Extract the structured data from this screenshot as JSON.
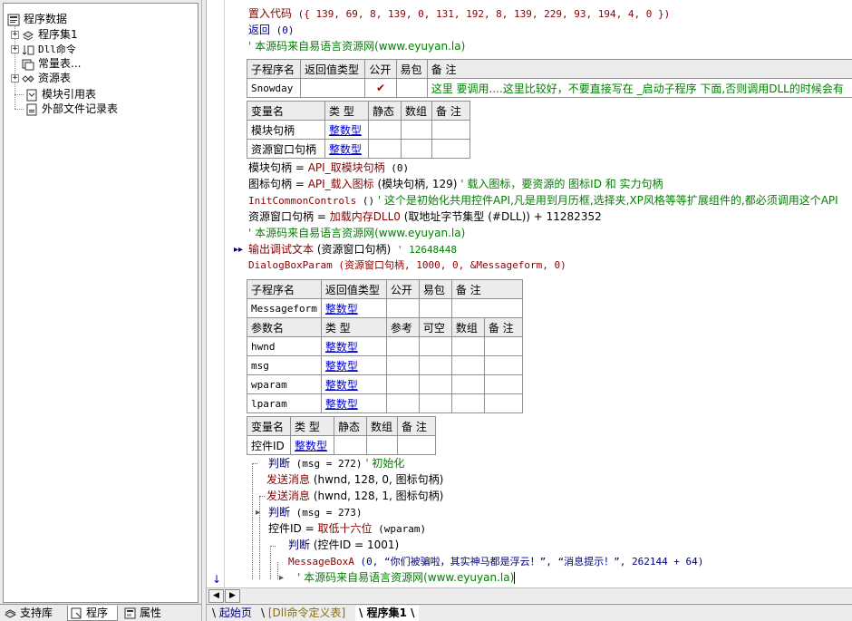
{
  "tree": {
    "root": "程序数据",
    "items": [
      {
        "label": "程序集1",
        "icon": "assembly-icon"
      },
      {
        "label": "Dll命令",
        "icon": "dll-icon"
      },
      {
        "label": "常量表...",
        "icon": "constant-icon"
      },
      {
        "label": "资源表",
        "icon": "resource-icon"
      },
      {
        "label": "模块引用表",
        "icon": "module-icon"
      },
      {
        "label": "外部文件记录表",
        "icon": "file-icon"
      }
    ]
  },
  "left_tabs": [
    "支持库",
    "程序",
    "属性"
  ],
  "code": {
    "l1_kw": "置入代码",
    "l1_args": " ({ 139, 69, 8, 139, 0, 131, 192, 8, 139, 229, 93, 194, 4, 0 })",
    "l2_kw": "返回",
    "l2_args": " (0)",
    "l3": "' 本源码来自易语言资源网(www.eyuyan.la)",
    "sub1": {
      "headers": [
        "子程序名",
        "返回值类型",
        "公开",
        "易包",
        "备 注"
      ],
      "name": "Snowday",
      "note": "这里 要调用....这里比较好，不要直接写在 _启动子程序 下面,否则调用DLL的时候会有"
    },
    "vars1": {
      "headers": [
        "变量名",
        "类 型",
        "静态",
        "数组",
        "备 注"
      ],
      "rows": [
        [
          "模块句柄",
          "整数型"
        ],
        [
          "资源窗口句柄",
          "整数型"
        ]
      ]
    },
    "l4_a": "模块句柄 = ",
    "l4_b": "API_取模块句柄",
    "l4_c": " (0)",
    "l5_a": "图标句柄 = ",
    "l5_b": "API_载入图标",
    "l5_c": " (模块句柄, 129)",
    "l5_d": " ' 载入图标，要资源的 图标ID 和 实力句柄",
    "l6_a": "InitCommonControls",
    "l6_b": " ()",
    "l6_c": " ' 这个是初始化共用控件API,凡是用到月历框,选择夹,XP风格等等扩展组件的,都必须调用这个API",
    "l7_a": "资源窗口句柄 = ",
    "l7_b": "加载内存DLL0",
    "l7_c": " (取地址字节集型 (#DLL)) + 11282352",
    "l8": "' 本源码来自易语言资源网(www.eyuyan.la)",
    "l9_a": "输出调试文本",
    "l9_b": " (资源窗口句柄)",
    "l9_c": " ' 12648448",
    "l10": "DialogBoxParam (资源窗口句柄, 1000, 0, &Messageform, 0)",
    "sub2": {
      "headers": [
        "子程序名",
        "返回值类型",
        "公开",
        "易包",
        "备 注"
      ],
      "name": "Messageform",
      "ret": "整数型",
      "param_headers": [
        "参数名",
        "类 型",
        "参考",
        "可空",
        "数组",
        "备 注"
      ],
      "params": [
        [
          "hwnd",
          "整数型"
        ],
        [
          "msg",
          "整数型"
        ],
        [
          "wparam",
          "整数型"
        ],
        [
          "lparam",
          "整数型"
        ]
      ]
    },
    "vars2": {
      "headers": [
        "变量名",
        "类 型",
        "静态",
        "数组",
        "备 注"
      ],
      "rows": [
        [
          "控件ID",
          "整数型"
        ]
      ]
    },
    "l11_a": "判断",
    "l11_b": " (msg = 272)",
    "l11_c": " ' 初始化",
    "l12_a": "发送消息",
    "l12_b": " (hwnd, 128, 0, 图标句柄)",
    "l13_a": "发送消息",
    "l13_b": " (hwnd, 128, 1, 图标句柄)",
    "l14_a": "判断",
    "l14_b": " (msg = 273)",
    "l15_a": "控件ID = ",
    "l15_b": "取低十六位",
    "l15_c": " (wparam)",
    "l16_a": "判断",
    "l16_b": " (控件ID = 1001)",
    "l17_a": "MessageBoxA",
    "l17_b": " (0, “你们被骗啦，其实神马都是浮云！”, “消息提示！”, 262144 + 64)",
    "l18": "' 本源码来自易语言资源网(www.eyuyan.la)"
  },
  "bottom_tabs": [
    "起始页",
    "[Dll命令定义表]",
    "程序集1"
  ]
}
